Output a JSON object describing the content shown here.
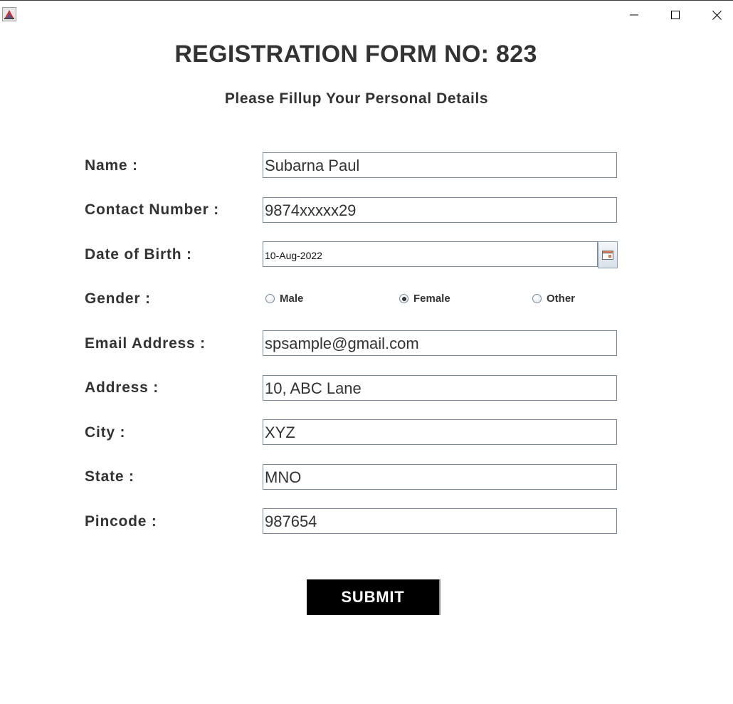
{
  "window": {
    "minimize_icon": "minimize-icon",
    "maximize_icon": "maximize-icon",
    "close_icon": "close-icon",
    "app_icon": "java-app-icon"
  },
  "form": {
    "title": "REGISTRATION FORM NO: 823",
    "subtitle": "Please Fillup Your Personal Details"
  },
  "fields": {
    "name": {
      "label": "Name :",
      "value": "Subarna Paul"
    },
    "contact": {
      "label": "Contact Number :",
      "value": "9874xxxxx29"
    },
    "dob": {
      "label": "Date of Birth :",
      "value": "10-Aug-2022",
      "button_icon": "calendar-icon"
    },
    "gender": {
      "label": "Gender :",
      "options": [
        {
          "label": "Male",
          "selected": false
        },
        {
          "label": "Female",
          "selected": true
        },
        {
          "label": "Other",
          "selected": false
        }
      ]
    },
    "email": {
      "label": "Email Address :",
      "value": "spsample@gmail.com"
    },
    "address": {
      "label": "Address :",
      "value": "10, ABC Lane"
    },
    "city": {
      "label": "City :",
      "value": "XYZ"
    },
    "state": {
      "label": "State :",
      "value": "MNO"
    },
    "pincode": {
      "label": "Pincode :",
      "value": "987654"
    }
  },
  "submit_label": "SUBMIT",
  "colors": {
    "submit_bg": "#000000",
    "text": "#333333",
    "field_border": "#7a8a99"
  }
}
